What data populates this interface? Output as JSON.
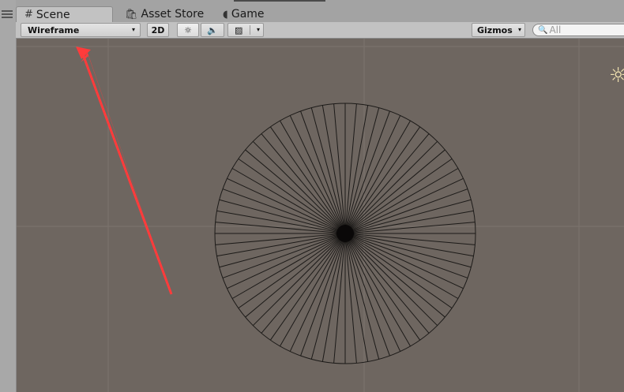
{
  "tabs": [
    {
      "label": "Scene",
      "icon": "grid-icon",
      "active": true
    },
    {
      "label": "Asset Store",
      "icon": "store-icon",
      "active": false
    },
    {
      "label": "Game",
      "icon": "game-pacman-icon",
      "active": false
    }
  ],
  "toolbar": {
    "draw_mode": "Wireframe",
    "btn_2d": "2D",
    "gizmos": "Gizmos",
    "search_placeholder": "All"
  },
  "scene": {
    "background_color": "#6e6660",
    "annotation_color": "#ff3333",
    "wireframe_color": "#1c1a18",
    "spoke_count": 72
  }
}
